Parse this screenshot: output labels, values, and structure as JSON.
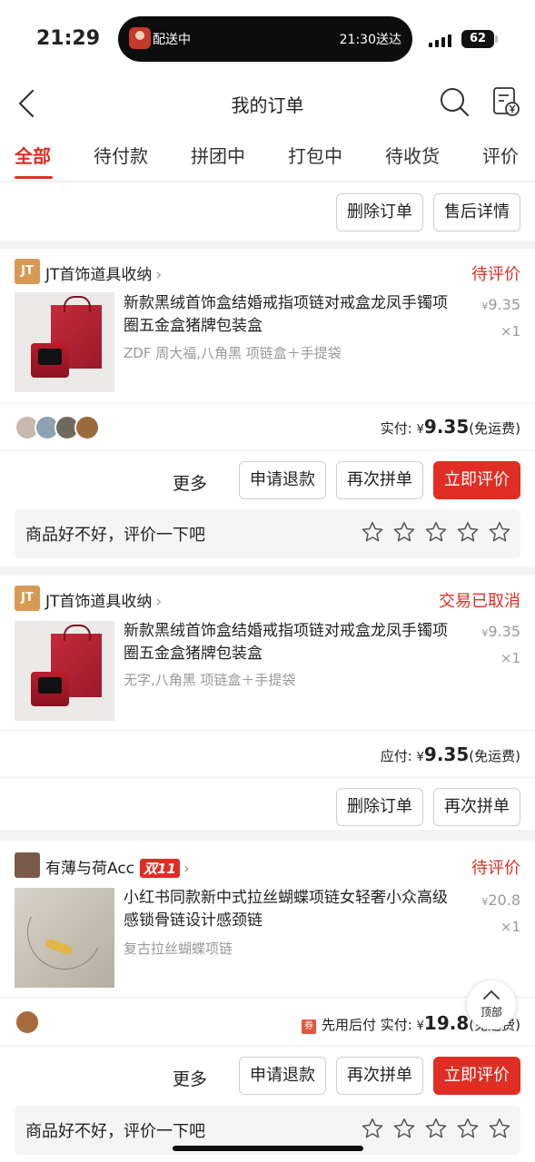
{
  "statusbar": {
    "time": "21:29",
    "delivery_status": "配送中",
    "delivery_eta": "21:30送达",
    "battery": "62"
  },
  "header": {
    "title": "我的订单",
    "back_icon": "chevron-left-icon",
    "search_icon": "search-icon",
    "bill_icon": "bill-yen-icon"
  },
  "tabs": [
    {
      "label": "全部",
      "active": true
    },
    {
      "label": "待付款"
    },
    {
      "label": "拼团中"
    },
    {
      "label": "打包中"
    },
    {
      "label": "待收货"
    },
    {
      "label": "评价"
    }
  ],
  "top_actions": {
    "delete": "删除订单",
    "aftersale": "售后详情"
  },
  "orders": [
    {
      "shop_logo": "JT",
      "shop_name": "JT首饰道具收纳",
      "status": "待评价",
      "product_title": "新款黑绒首饰盒结婚戒指项链对戒盒龙凤手镯项圈五金盒猪牌包装盒",
      "spec": "ZDF 周大福,八角黑 项链盒＋手提袋",
      "price_symbol": "¥",
      "price": "9.35",
      "qty": "×1",
      "pay_label": "实付:",
      "pay_symbol": "¥",
      "pay_amount": "9.35",
      "pay_note": "(免运费)",
      "buttons": {
        "more": "更多",
        "refund": "申请退款",
        "regroup": "再次拼单",
        "review": "立即评价"
      },
      "review_prompt": "商品好不好，评价一下吧"
    },
    {
      "shop_logo": "JT",
      "shop_name": "JT首饰道具收纳",
      "status": "交易已取消",
      "product_title": "新款黑绒首饰盒结婚戒指项链对戒盒龙凤手镯项圈五金盒猪牌包装盒",
      "spec": "无字,八角黑 项链盒＋手提袋",
      "price_symbol": "¥",
      "price": "9.35",
      "qty": "×1",
      "pay_label": "应付:",
      "pay_symbol": "¥",
      "pay_amount": "9.35",
      "pay_note": "(免运费)",
      "buttons": {
        "delete": "删除订单",
        "regroup": "再次拼单"
      }
    },
    {
      "shop_name": "有薄与荷Acc",
      "shop_tag": "双11",
      "status": "待评价",
      "product_title": "小红书同款新中式拉丝蝴蝶项链女轻奢小众高级感锁骨链设计感颈链",
      "spec": "复古拉丝蝴蝶项链",
      "price_symbol": "¥",
      "price": "20.8",
      "qty": "×1",
      "coupon_icon": "券",
      "pay_prefix": "先用后付",
      "pay_label": "实付:",
      "pay_symbol": "¥",
      "pay_amount": "19.8",
      "pay_note": "(免运费)",
      "buttons": {
        "more": "更多",
        "refund": "申请退款",
        "regroup": "再次拼单",
        "review": "立即评价"
      },
      "review_prompt": "商品好不好，评价一下吧"
    }
  ],
  "back_to_top": "顶部",
  "colors": {
    "accent": "#e02e24",
    "muted": "#999999",
    "logo": "#d79a52"
  }
}
